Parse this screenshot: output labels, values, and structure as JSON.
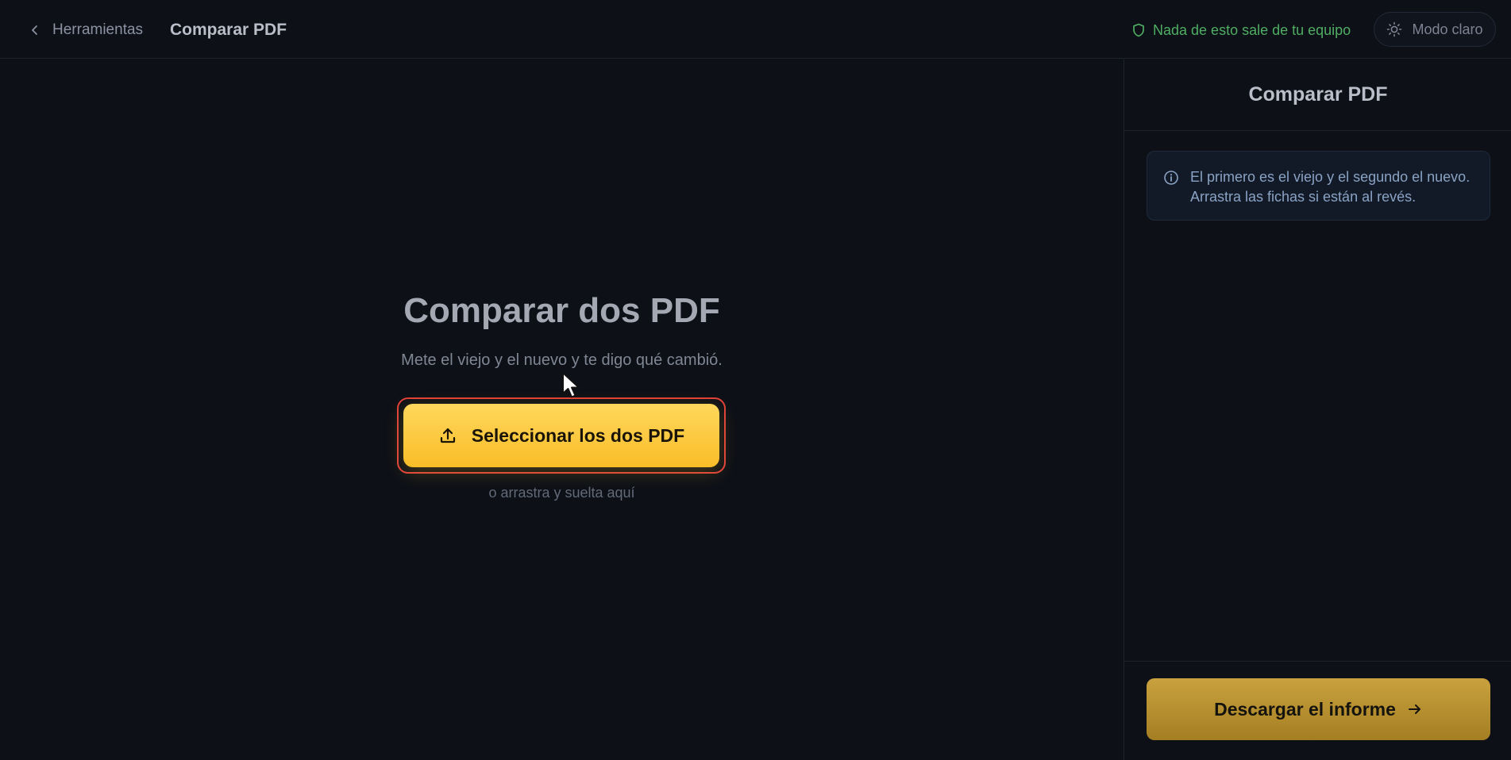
{
  "topbar": {
    "back_label": "Herramientas",
    "title": "Comparar PDF",
    "privacy_text": "Nada de esto sale de tu equipo",
    "theme_label": "Modo claro"
  },
  "main": {
    "title": "Comparar dos PDF",
    "subtitle": "Mete el viejo y el nuevo y te digo qué cambió.",
    "upload_label": "Seleccionar los dos PDF",
    "drop_hint": "o arrastra y suelta aquí"
  },
  "sidebar": {
    "title": "Comparar PDF",
    "info_text": "El primero es el viejo y el segundo el nuevo. Arrastra las fichas si están al revés.",
    "download_label": "Descargar el informe"
  },
  "colors": {
    "background": "#0d1017",
    "accent": "#f9bd28",
    "accent_muted": "#b58d2e",
    "privacy": "#4fae63",
    "focus_ring": "#e0403a"
  },
  "icons": {
    "back": "chevron-left-icon",
    "privacy": "shield-icon",
    "theme": "sun-icon",
    "upload": "upload-icon",
    "info": "info-icon",
    "download": "arrow-right-icon"
  }
}
